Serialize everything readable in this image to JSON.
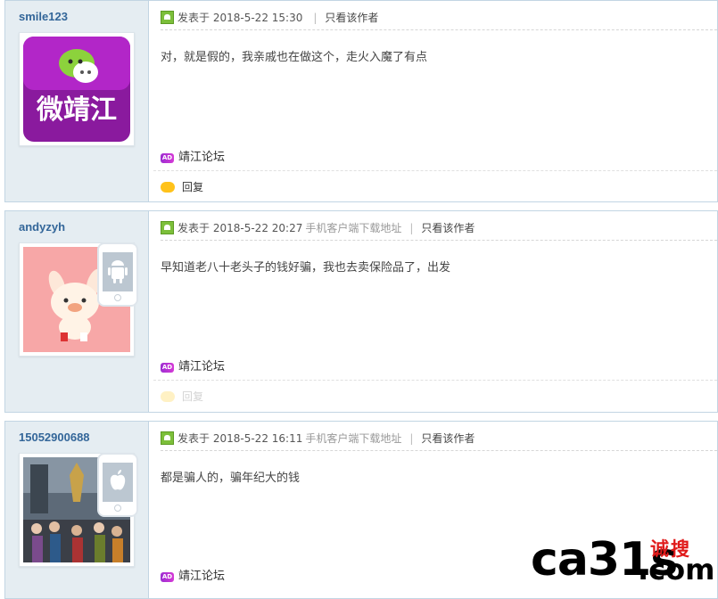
{
  "posts": [
    {
      "username": "smile123",
      "posted_label": "发表于",
      "datetime": "2018-5-22 15:30",
      "mobile_link": "",
      "author_only": "只看该作者",
      "message": "对，就是假的，我亲戚也在做这个，走火入魔了有点",
      "forum": "靖江论坛",
      "reply": "回复",
      "avatar_text": "微靖江"
    },
    {
      "username": "andyzyh",
      "posted_label": "发表于",
      "datetime": "2018-5-22 20:27",
      "mobile_link": "手机客户端下载地址",
      "author_only": "只看该作者",
      "message": "早知道老八十老头子的钱好骗，我也去卖保险品了，出发",
      "forum": "靖江论坛",
      "reply": "回复"
    },
    {
      "username": "15052900688",
      "posted_label": "发表于",
      "datetime": "2018-5-22 16:11",
      "mobile_link": "手机客户端下载地址",
      "author_only": "只看该作者",
      "message": "都是骗人的，骗年纪大的钱",
      "forum": "靖江论坛"
    }
  ],
  "ad_badge": "AD",
  "watermark": {
    "main": "ca31s",
    "cn": "诚搜",
    "com": ".com"
  },
  "colors": {
    "username": "#336699",
    "sidebar": "#e5edf2",
    "border": "#c2d5e3",
    "watermark_red": "#e01a1a"
  },
  "icons": [
    "post-icon",
    "ad-icon",
    "reply-bubble-icon",
    "android-phone-icon",
    "apple-phone-icon"
  ]
}
